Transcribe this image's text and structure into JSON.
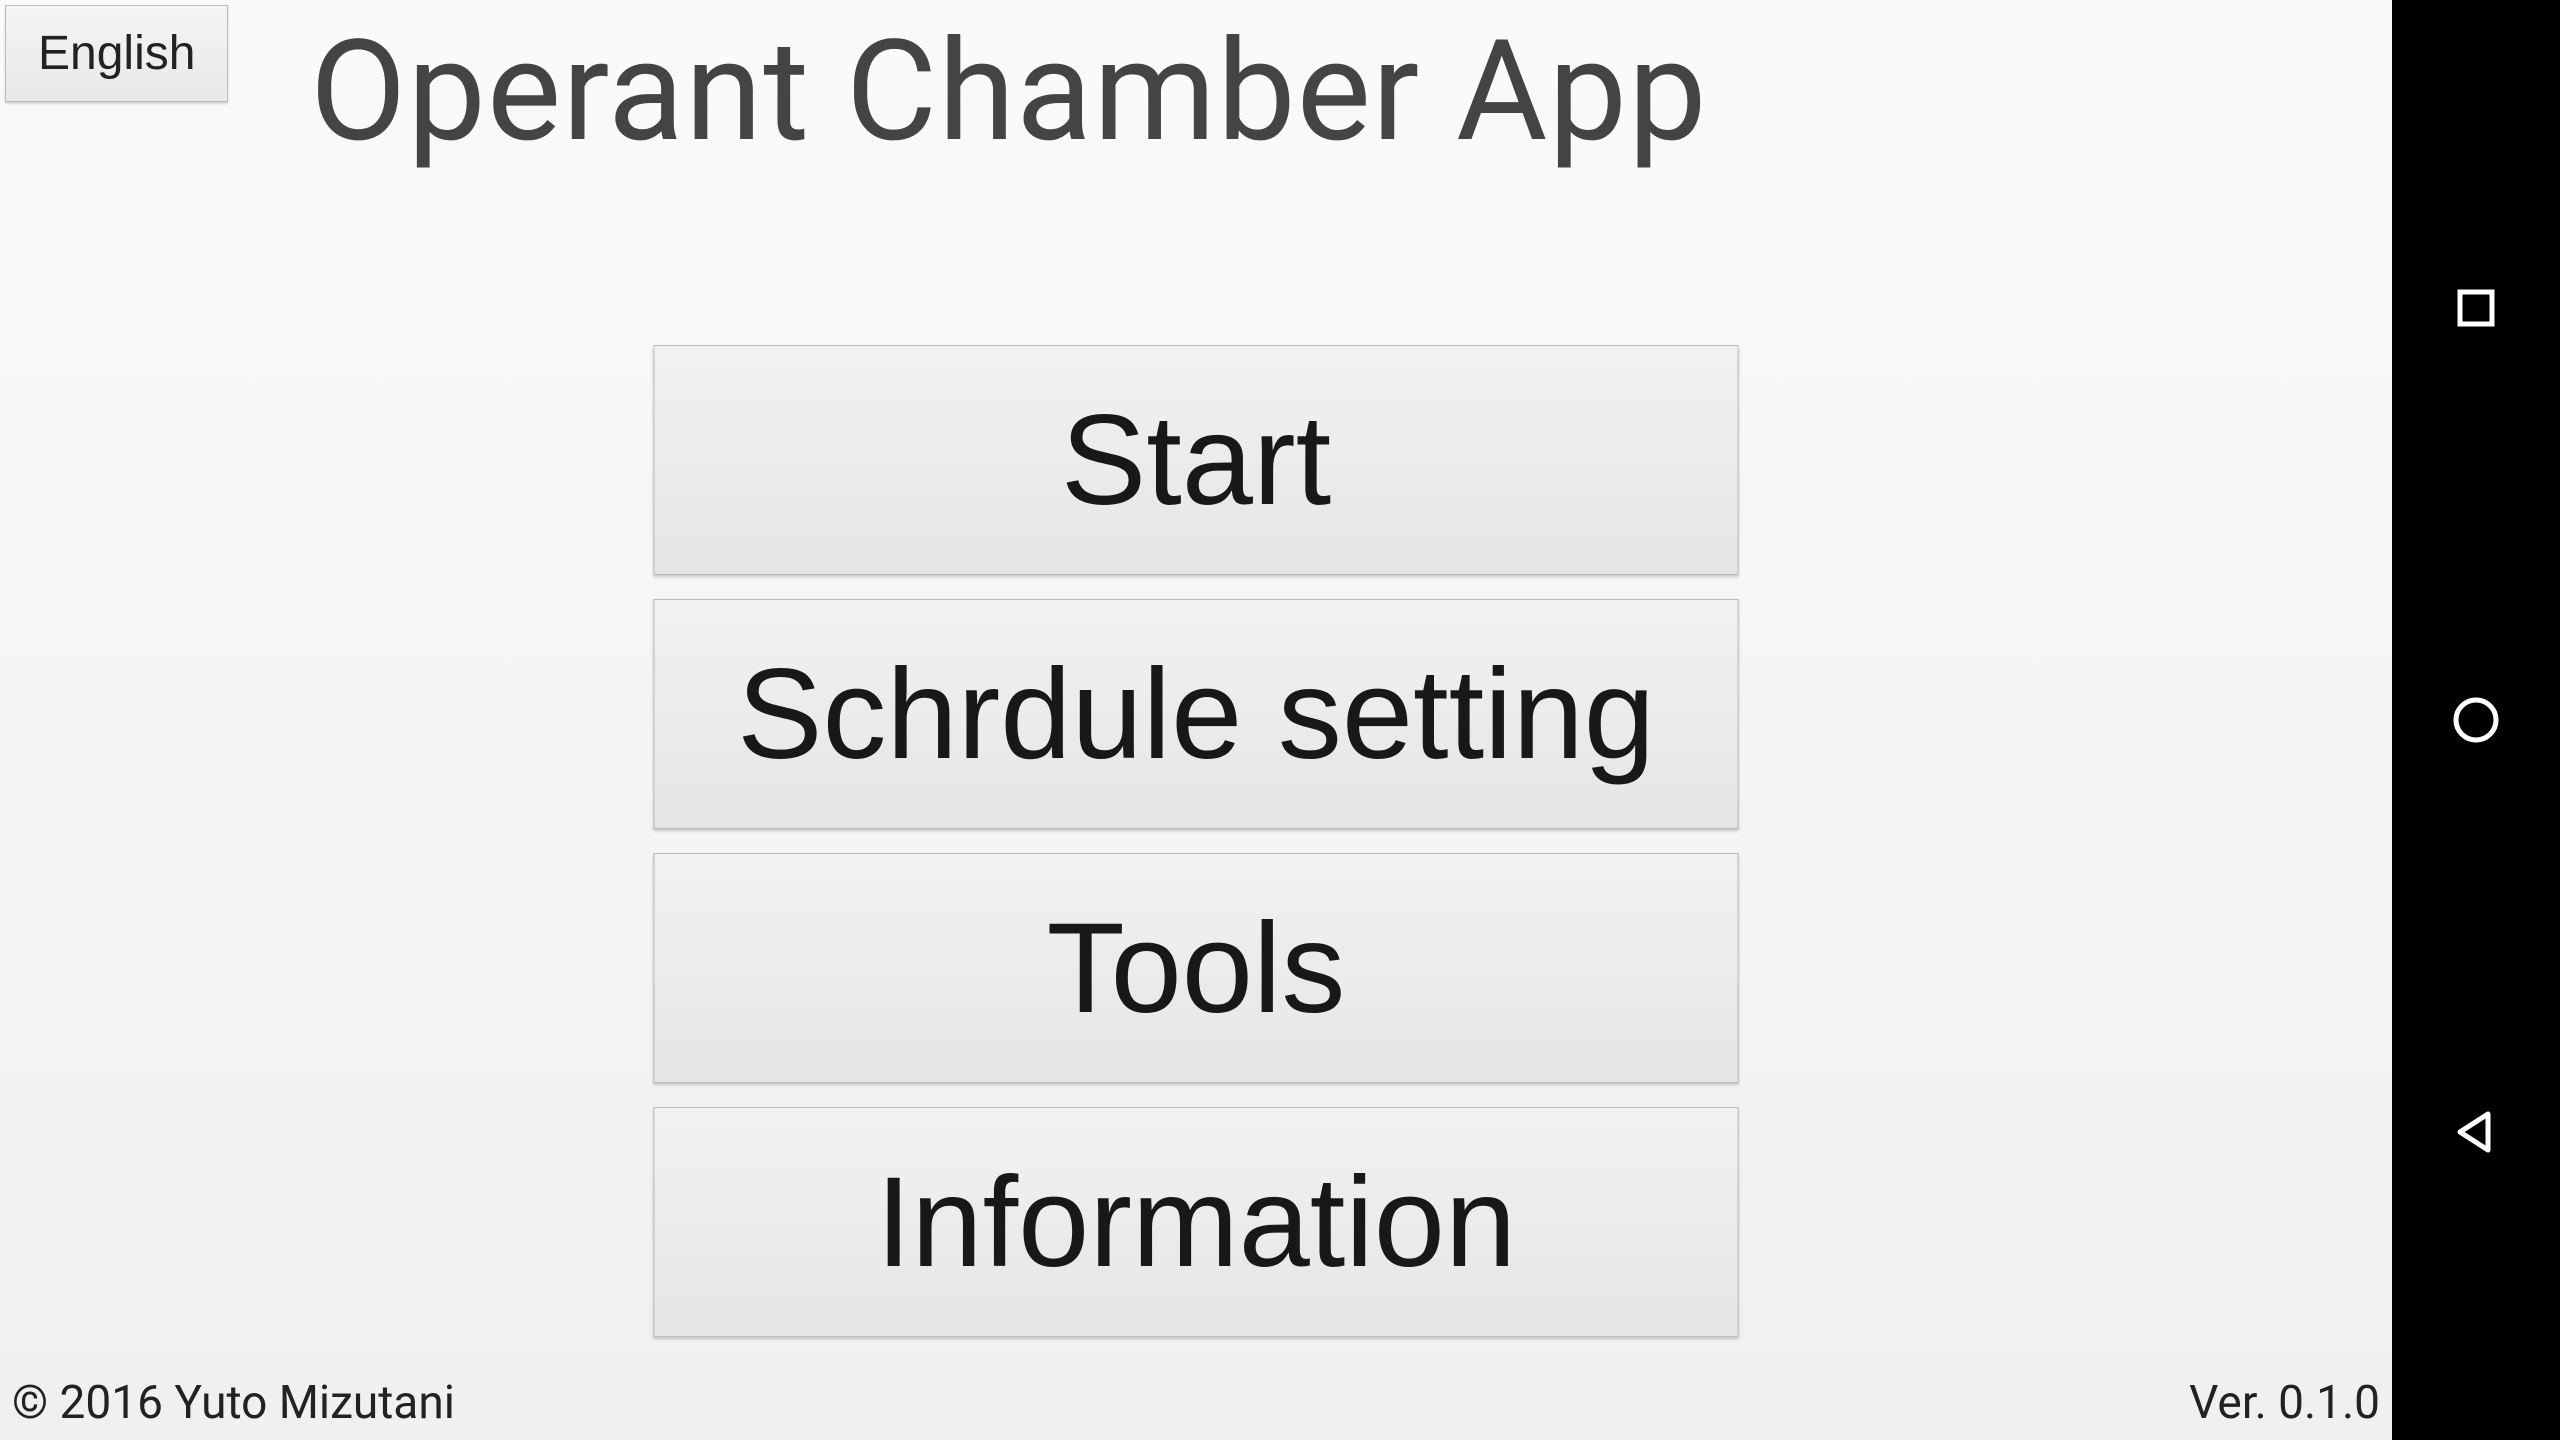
{
  "header": {
    "language_button": "English",
    "title": "Operant Chamber App"
  },
  "menu": {
    "start": "Start",
    "schedule_setting": "Schrdule setting",
    "tools": "Tools",
    "information": "Information"
  },
  "footer": {
    "copyright": "© 2016 Yuto Mizutani",
    "version": "Ver. 0.1.0"
  }
}
